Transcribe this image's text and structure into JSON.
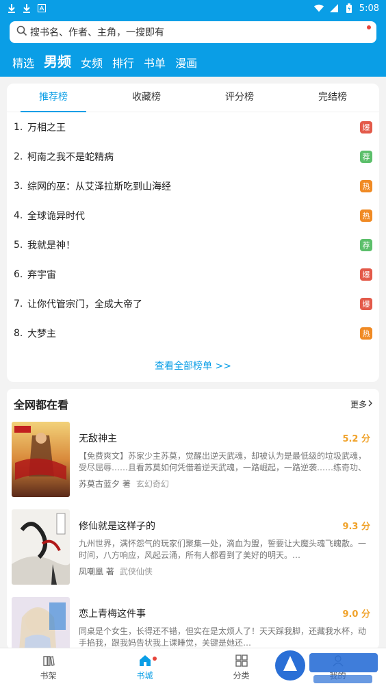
{
  "status_bar": {
    "time": "5:08"
  },
  "search": {
    "placeholder": "搜书名、作者、主角，一搜即有"
  },
  "channel_tabs": [
    "精选",
    "男频",
    "女频",
    "排行",
    "书单",
    "漫画"
  ],
  "channel_active_index": 1,
  "rank_tabs": [
    "推荐榜",
    "收藏榜",
    "评分榜",
    "完结榜"
  ],
  "rank_active_index": 0,
  "rank_items": [
    {
      "num": "1.",
      "title": "万相之王",
      "badge": "爆",
      "color": "#e35a4a"
    },
    {
      "num": "2.",
      "title": "柯南之我不是蛇精病",
      "badge": "荐",
      "color": "#5cbf6b"
    },
    {
      "num": "3.",
      "title": "综网的巫：从艾泽拉斯吃到山海经",
      "badge": "热",
      "color": "#f08a24"
    },
    {
      "num": "4.",
      "title": "全球诡异时代",
      "badge": "热",
      "color": "#f08a24"
    },
    {
      "num": "5.",
      "title": "我就是神！",
      "badge": "荐",
      "color": "#5cbf6b"
    },
    {
      "num": "6.",
      "title": "弃宇宙",
      "badge": "爆",
      "color": "#e35a4a"
    },
    {
      "num": "7.",
      "title": "让你代管宗门，全成大帝了",
      "badge": "爆",
      "color": "#e35a4a"
    },
    {
      "num": "8.",
      "title": "大梦主",
      "badge": "热",
      "color": "#f08a24"
    }
  ],
  "rank_view_all": "查看全部榜单 >>",
  "recommend": {
    "title": "全网都在看",
    "more": "更多",
    "books": [
      {
        "title": "无敌神主",
        "score": "5.2 分",
        "desc": "【免费爽文】苏家少主苏莫，觉醒出逆天武魂，却被认为是最低级的垃圾武魂，受尽屈辱……且看苏莫如何凭借着逆天武魂，一路崛起，一路逆袭……练奇功、得…",
        "author": "苏莫古蓝夕 著",
        "genre": "玄幻奇幻"
      },
      {
        "title": "修仙就是这样子的",
        "score": "9.3 分",
        "desc": "九州世界，满怀怨气的玩家们聚集一处，滴血为盟，誓要让大魔头魂飞魄散。一时间，八方响应，风起云涌，所有人都看到了美好的明天。…",
        "author": "凤嘲凰 著",
        "genre": "武侠仙侠"
      },
      {
        "title": "恋上青梅这件事",
        "score": "9.0 分",
        "desc": "同桌是个女生，长得还不错，但实在是太烦人了！天天踩我脚，还藏我水杯，动手掐我，跟我妈告状我上课睡觉，关键是她还…",
        "author": "",
        "genre": ""
      }
    ]
  },
  "bottom_nav": [
    {
      "label": "书架",
      "icon": "bookshelf-icon"
    },
    {
      "label": "书城",
      "icon": "home-icon"
    },
    {
      "label": "分类",
      "icon": "category-icon"
    },
    {
      "label": "我的",
      "icon": "profile-icon"
    }
  ],
  "bottom_active_index": 1,
  "colors": {
    "accent": "#0a9ee6",
    "score": "#f0a22a"
  }
}
